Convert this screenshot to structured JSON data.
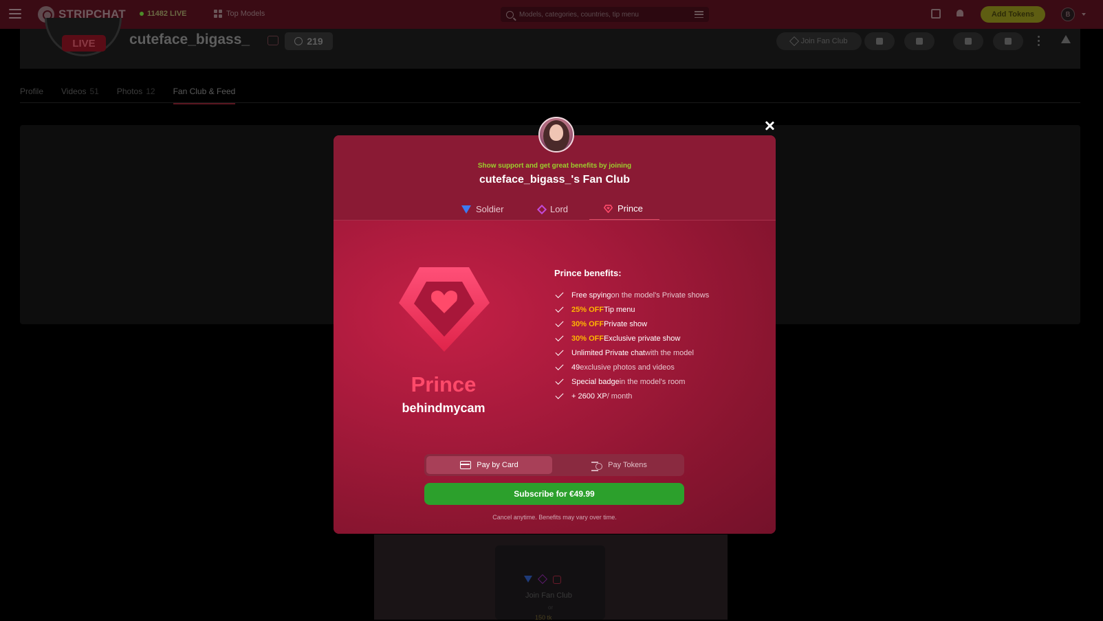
{
  "topbar": {
    "logo_text": "STRIPCHAT",
    "live_count": "11482 LIVE",
    "top_models": "Top Models",
    "search_placeholder": "Models, categories, countries, tip menu",
    "add_tokens": "Add Tokens",
    "user_initial": "B"
  },
  "profile": {
    "live_badge": "LIVE",
    "name": "cuteface_bigass_",
    "viewers": "219",
    "join_fan_club": "Join Fan Club",
    "tabs": [
      {
        "label": "Profile",
        "count": ""
      },
      {
        "label": "Videos",
        "count": "51"
      },
      {
        "label": "Photos",
        "count": "12"
      },
      {
        "label": "Fan Club & Feed",
        "count": ""
      }
    ],
    "active_tab": "Fan Club & Feed"
  },
  "feed_card": {
    "join": "Join Fan Club",
    "or": "or",
    "price": "150 tk"
  },
  "modal": {
    "support_text": "Show support and get great benefits by joining",
    "title": "cuteface_bigass_'s Fan Club",
    "tiers": [
      {
        "label": "Soldier",
        "icon": "triangle-gem-icon",
        "color": "#3d7af0"
      },
      {
        "label": "Lord",
        "icon": "diamond-gem-icon",
        "color": "#c34ad8"
      },
      {
        "label": "Prince",
        "icon": "heart-gem-icon",
        "color": "#ff4a6a"
      }
    ],
    "selected_tier": "Prince",
    "tier_name": "Prince",
    "tier_sub": "behindmycam",
    "benefits_title": "Prince benefits:",
    "benefits": [
      {
        "bold": "Free spying",
        "highlight": "",
        "rest": " on the model's Private shows"
      },
      {
        "bold": "",
        "highlight": "25% OFF",
        "rest": " Tip menu"
      },
      {
        "bold": "",
        "highlight": "30% OFF",
        "rest": " Private show"
      },
      {
        "bold": "",
        "highlight": "30% OFF",
        "rest": " Exclusive private show"
      },
      {
        "bold": "Unlimited Private chat",
        "highlight": "",
        "rest": " with the model"
      },
      {
        "bold": "49",
        "highlight": "",
        "rest": " exclusive photos and videos"
      },
      {
        "bold": "Special badge",
        "highlight": "",
        "rest": " in the model's room"
      },
      {
        "bold": "+ 2600 XP",
        "highlight": "",
        "rest": " / month"
      }
    ],
    "pay_by_card": "Pay by Card",
    "pay_tokens": "Pay Tokens",
    "selected_payment": "Pay by Card",
    "subscribe": "Subscribe for €49.99",
    "cancel_note": "Cancel anytime. Benefits may vary over time."
  },
  "colors": {
    "accent_pink": "#ff4a6a",
    "support_green": "#9ccf2e",
    "discount_gold": "#ffb800",
    "subscribe_green": "#2ca02c"
  }
}
